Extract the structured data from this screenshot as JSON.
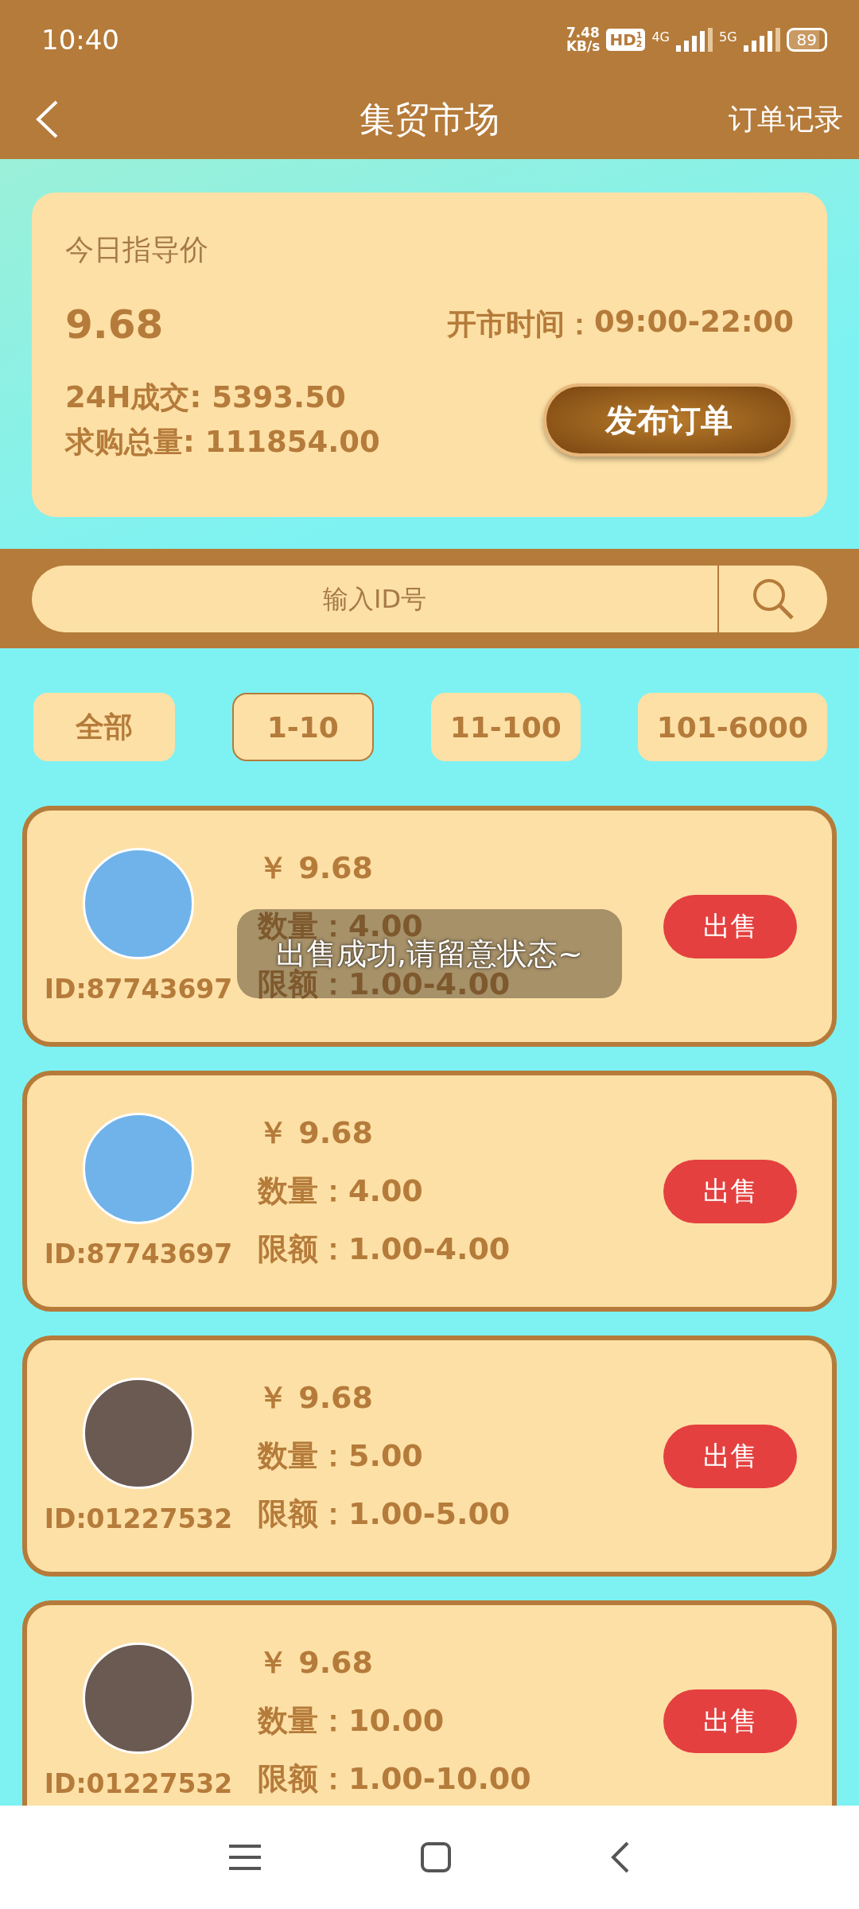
{
  "status_bar": {
    "time": "10:40",
    "speed_value": "7.48",
    "speed_unit": "KB/s",
    "hd": "HD",
    "hd_sub": [
      "1",
      "2"
    ],
    "sim1": "4G",
    "sim2": "5G",
    "battery": "89"
  },
  "header": {
    "title": "集贸市场",
    "action": "订单记录"
  },
  "summary": {
    "label": "今日指导价",
    "price": "9.68",
    "hours_label": "开市时间：",
    "hours": "09:00-22:00",
    "volume": "24H成交: 5393.50",
    "demand": "求购总量: 111854.00",
    "publish_button": "发布订单"
  },
  "search": {
    "placeholder": "输入ID号"
  },
  "filters": [
    {
      "label": "全部",
      "selected": false
    },
    {
      "label": "1-10",
      "selected": true
    },
    {
      "label": "11-100",
      "selected": false
    },
    {
      "label": "101-6000",
      "selected": false
    }
  ],
  "orders": [
    {
      "id": "ID:87743697",
      "price": "￥ 9.68",
      "quantity": "数量：4.00",
      "limit": "限额：1.00-4.00",
      "button": "出售"
    },
    {
      "id": "ID:87743697",
      "price": "￥ 9.68",
      "quantity": "数量：4.00",
      "limit": "限额：1.00-4.00",
      "button": "出售"
    },
    {
      "id": "ID:01227532",
      "price": "￥ 9.68",
      "quantity": "数量：5.00",
      "limit": "限额：1.00-5.00",
      "button": "出售"
    },
    {
      "id": "ID:01227532",
      "price": "￥ 9.68",
      "quantity": "数量：10.00",
      "limit": "限额：1.00-10.00",
      "button": "出售"
    }
  ],
  "toast": {
    "text": "出售成功,请留意状态~"
  }
}
